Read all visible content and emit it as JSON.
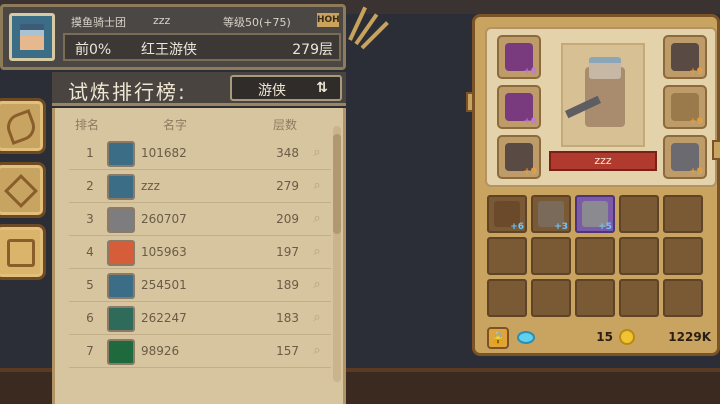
{
  "profile": {
    "guild": "摸鱼骑士团",
    "username": "zzz",
    "level_text": "等级50(+75)",
    "badge": "HOH",
    "rank_percent": "前0%",
    "hero": "红王游侠",
    "floor": "279层"
  },
  "leaderboard": {
    "title": "试炼排行榜:",
    "class_filter": "游侠",
    "headers": {
      "rank": "排名",
      "name": "名字",
      "floor": "层数"
    },
    "rows": [
      {
        "rank": "1",
        "id": "101682",
        "floor": "348",
        "avatar_color": "#3b6e86"
      },
      {
        "rank": "2",
        "id": "zzz",
        "floor": "279",
        "avatar_color": "#3b6e86"
      },
      {
        "rank": "3",
        "id": "260707",
        "floor": "209",
        "avatar_color": "#7d7d80"
      },
      {
        "rank": "4",
        "id": "105963",
        "floor": "197",
        "avatar_color": "#d65d3a"
      },
      {
        "rank": "5",
        "id": "254501",
        "floor": "189",
        "avatar_color": "#3b6e86"
      },
      {
        "rank": "6",
        "id": "262247",
        "floor": "183",
        "avatar_color": "#2e6b5a"
      },
      {
        "rank": "7",
        "id": "98926",
        "floor": "157",
        "avatar_color": "#1f6a3c"
      }
    ]
  },
  "equipment": {
    "player_name": "zzz",
    "left_slots": [
      {
        "level": "+8",
        "color": "#7a3a7e",
        "level_color": "#c07ad8"
      },
      {
        "level": "+8",
        "color": "#7a3a7e",
        "level_color": "#c07ad8"
      },
      {
        "level": "+9",
        "color": "#5a4a44",
        "level_color": "#e8a040"
      }
    ],
    "right_slots": [
      {
        "level": "+9",
        "color": "#5a4a44",
        "level_color": "#e8a040"
      },
      {
        "level": "+9",
        "color": "#9a7a4a",
        "level_color": "#e8a040"
      },
      {
        "level": "+9",
        "color": "#6a6a70",
        "level_color": "#e8a040"
      }
    ],
    "inventory": [
      {
        "level": "+6",
        "color": "#6a4a2a",
        "purple": false
      },
      {
        "level": "+3",
        "color": "#7a6a5a",
        "purple": false
      },
      {
        "level": "+5",
        "color": "#8a8a90",
        "purple": true
      }
    ],
    "gems": "15",
    "coins": "1229K"
  }
}
